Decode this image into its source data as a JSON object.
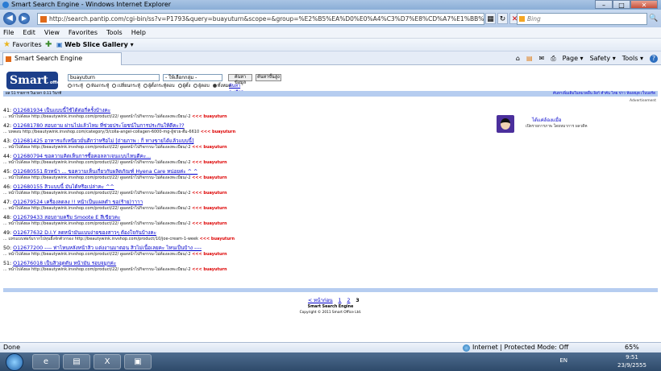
{
  "window": {
    "title": "Smart Search Engine - Windows Internet Explorer",
    "minimize": "–",
    "maximize": "□",
    "close": "✕"
  },
  "address_bar": {
    "url": "http://search.pantip.com/cgi-bin/ss?v=P1793&query=buayuturn&scope=&group=%E2%B5%EA%D0%E0%A4%C3%D7%E8%CD%A7%E1%BB%E9%A7&page=3",
    "search_placeholder": "Bing",
    "back": "◀",
    "forward": "▶",
    "go": "🔍"
  },
  "menu": [
    "File",
    "Edit",
    "View",
    "Favorites",
    "Tools",
    "Help"
  ],
  "favorites_bar": {
    "favorites_label": "Favorites",
    "web_slice_label": "Web Slice Gallery ▾"
  },
  "tab": {
    "label": "Smart Search Engine"
  },
  "command_bar": [
    "Page ▾",
    "Safety ▾",
    "Tools ▾",
    "?"
  ],
  "search_form": {
    "logo": "Smart",
    "logo_sub": "office",
    "query": "buayuturn",
    "select_value": "- ให้เลือกกลุ่ม -",
    "search_button": "ค้นหาข้อมูล",
    "help_button": "ค้นหาขั้นสูง",
    "radios": [
      "กระทู้",
      "ห้องกระทู้",
      "เปลี่ยนกระทู้",
      "ผู้ตั้งกระทู้ตอบ",
      "ผู้ตั้ง",
      "ผู้ตอบ",
      "ทั้งหมด"
    ],
    "advanced_link": "ค้นหาละเอียด"
  },
  "result_bar": {
    "left": "ผล 51 รายการ ในเวลา 0.11 วินาที",
    "right": "ค้นหาเพิ่มเติมในหมวดอื่น   ลิงก์   คำค้น   ไทย   ข่าว   ห้องสมุด   เว็บบอร์ด"
  },
  "advertisement_label": "Advertisement",
  "results": [
    {
      "num": "41:",
      "title": "O12681934 เป็นแบบนี้ใช้ได้ต่อกี่ครั้งบ้างคะ",
      "snippet": "... หน้าไปดังผล  http://beautywink.invshop.com/product/22/ ดูผลหน้าไปกิจกรรม-ไม่ต้องลงทะเบียน/-2",
      "keyword": "<<< buayuturn"
    },
    {
      "num": "42:",
      "title": "O12681780 สอบถาม ผ่านไปแล้วไหม ที่ช่วยประโยชน์ในการประกันให้ดีคะ??",
      "snippet": "... บทตอบ  http://beautywink.invshop.com/category/3/colla-angel-collagen-6000-mg-ผู้ช่วย-ดื่ม-6610",
      "keyword": "<<< buayuturn"
    },
    {
      "num": "43:",
      "title": "O12681425 อาหารแก้เหนียวมั่นดีกว่าหรือไม่ [ถ่ายภาพ : ก็ ทางขายได้แล้วแบบนี้]",
      "snippet": "... หน้าไปดังผล  http://beautywink.invshop.com/product/22/ ดูผลหน้าไปกิจกรรม-ไม่ต้องลงทะเบียน/-2",
      "keyword": "<<< buayuturn"
    },
    {
      "num": "44:",
      "title": "O12680794 ขอความคิดเห็นการซื้อคอลลาเจนแบบไหนดีคะ...",
      "snippet": "... หน้าไปดังผล  http://beautywink.invshop.com/product/22/ ดูผลหน้าไปกิจกรรม-ไม่ต้องลงทะเบียน/-2",
      "keyword": "<<< buayuturn"
    },
    {
      "num": "45:",
      "title": "O12680551 ผิวหน้า ... ขอความเห็นเกี่ยวกับผลิตภัณฑ์ Hyena Care หน่อยค่ะ ^ ^",
      "snippet": "... หน้าไปดังผล  http://beautywink.invshop.com/product/22/ ดูผลหน้าไปกิจกรรม-ไม่ต้องลงทะเบียน/-2",
      "keyword": "<<< buayuturn"
    },
    {
      "num": "46:",
      "title": "O12680155 สิวแบบนี้ มันได้หรือเปล่าคะ ^^",
      "snippet": "... หน้าไปดังผล  http://beautywink.invshop.com/product/22/ ดูผลหน้าไปกิจกรรม-ไม่ต้องลงทะเบียน/-2",
      "keyword": "<<< buayuturn"
    },
    {
      "num": "47:",
      "title": "O12679524 เครื่องลดลง !! หน้าเป็นแผลดำ ขอ(ร้าย)าาาา",
      "snippet": "... หน้าไปดังผล  http://beautywink.invshop.com/product/22/ ดูผลหน้าไปกิจกรรม-ไม่ต้องลงทะเบียน/-2",
      "keyword": "<<< buayuturn"
    },
    {
      "num": "48:",
      "title": "O12679433 สอบถามครีม Smoote E สีเขียวคะ",
      "snippet": "... หน้าไปดังผล  http://beautywink.invshop.com/product/22/ ดูผลหน้าไปกิจกรรม-ไม่ต้องลงทะเบียน/-2",
      "keyword": "<<< buayuturn"
    },
    {
      "num": "49:",
      "title": "O12677632 D.I.Y ลดหน้ามันแบบง่ายของสาวๆ ต้องใจกันบ้างคะ",
      "snippet": "... แทรแบบฟอร์มรากไปหุนยิ้งจักตัวกรอง  http://beautywink.invshop.com/product/10/joe-cream-1-week",
      "keyword": "<<< buayuturn"
    },
    {
      "num": "50:",
      "title": "O12677200 ---- ท่าไหนหลังหน้าสิว แต่งงานมาตอน สิวไม่เนื้อเลยคะ ไหนเป็นบ้าง ----",
      "snippet": "... หน้าไปดังผล  http://beautywink.invshop.com/product/22/ ดูผลหน้าไปกิจกรรม-ไม่ต้องลงทะเบียน/-2",
      "keyword": "<<< buayuturn"
    },
    {
      "num": "51:",
      "title": "O12676018 เป็นสิวอุดตัน หน้ามัน รอบจมูกค่ะ",
      "snippet": "... หน้าไปดังผล  http://beautywink.invshop.com/product/22/ ดูผลหน้าไปกิจกรรม-ไม่ต้องลงทะเบียน/-2",
      "keyword": "<<< buayuturn"
    }
  ],
  "ad": {
    "title": "ได้แค่ล้องแมื่อ",
    "text": "เปิดรายการภาพ  โดยหมาการ  ผลวดีค"
  },
  "pagination": {
    "prev": "< หน้าก่อน",
    "pages": [
      "1",
      "2"
    ],
    "current": "3"
  },
  "footer": {
    "line1": "Smart Search Engine",
    "line2": "Copyright © 2011 Smart Office Ltd."
  },
  "status_bar": {
    "left": "Done",
    "zone": "Internet | Protected Mode: Off",
    "zoom": "65%"
  },
  "taskbar": {
    "lang": "EN",
    "time": "9:51",
    "date": "23/9/2555"
  }
}
